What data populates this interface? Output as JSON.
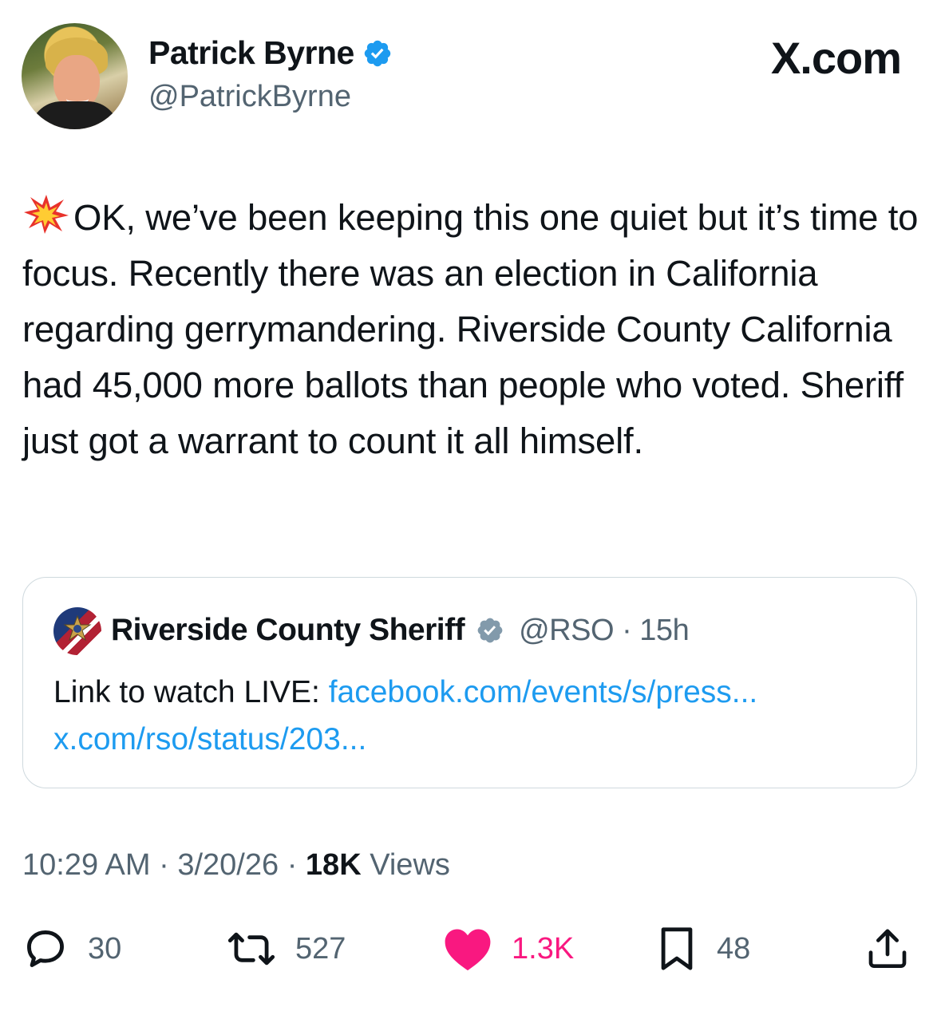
{
  "tweet": {
    "author_name": "Patrick Byrne",
    "author_handle": "@PatrickByrne",
    "brand": "X.com",
    "text": "OK, we’ve been keeping this one quiet but it’s time to focus. Recently there was an election in California regarding gerrymandering. Riverside County California had 45,000 more ballots than people who voted. Sheriff just got a warrant to count it all himself.",
    "lead_emoji": "collision-emoji",
    "time": "10:29 AM",
    "date": "3/20/26",
    "views_count": "18K",
    "views_label": "Views",
    "separator": "·"
  },
  "quote": {
    "author_name": "Riverside County Sheriff",
    "author_handle": "@RSO",
    "age": "15h",
    "text_prefix": "Link to watch LIVE: ",
    "link1": "facebook.com/events/s/press...",
    "link2": "x.com/rso/status/203..."
  },
  "actions": {
    "replies": "30",
    "reposts": "527",
    "likes": "1.3K",
    "bookmarks": "48"
  },
  "colors": {
    "verified_blue": "#1d9bf0",
    "verified_gray": "#829aab",
    "link": "#1d9bf0",
    "like_pink": "#f91880",
    "muted": "#536471"
  }
}
